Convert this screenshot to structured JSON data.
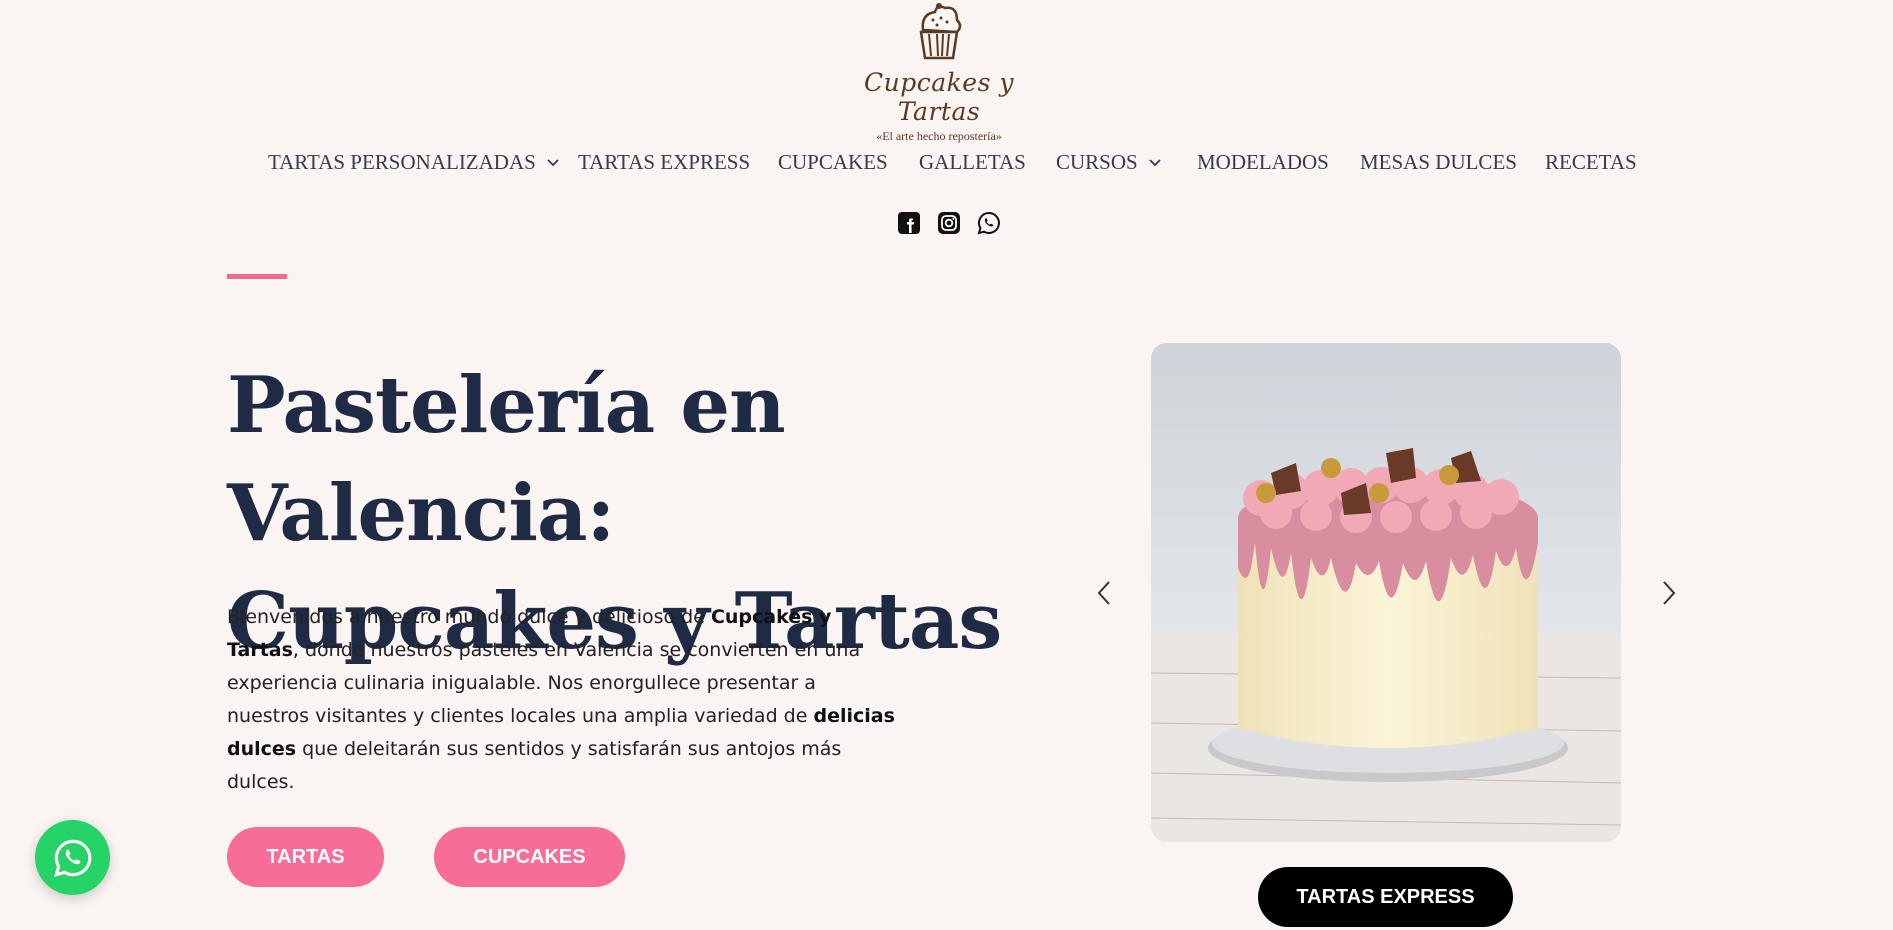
{
  "brand": {
    "name": "Cupcakes y Tartas",
    "tagline": "«El arte hecho repostería»"
  },
  "nav": {
    "items": [
      {
        "label": "TARTAS PERSONALIZADAS",
        "has_dropdown": true
      },
      {
        "label": "TARTAS EXPRESS",
        "has_dropdown": false
      },
      {
        "label": "CUPCAKES",
        "has_dropdown": false
      },
      {
        "label": "GALLETAS",
        "has_dropdown": false
      },
      {
        "label": "CURSOS",
        "has_dropdown": true
      },
      {
        "label": "MODELADOS",
        "has_dropdown": false
      },
      {
        "label": "MESAS DULCES",
        "has_dropdown": false
      },
      {
        "label": "RECETAS",
        "has_dropdown": false
      }
    ]
  },
  "social": [
    "facebook-icon",
    "instagram-icon",
    "whatsapp-icon"
  ],
  "hero": {
    "title_line1": "Pastelería en Valencia:",
    "title_line2": "Cupcakes y Tartas",
    "intro_part1": "Bienvenidos a nuestro mundo dulce y delicioso de ",
    "intro_bold1": "Cupcakes y Tartas",
    "intro_part2": ", donde nuestros pasteles en Valencia se convierten en una experiencia culinaria inigualable. Nos enorgullece presentar a nuestros visitantes y clientes locales una amplia variedad de ",
    "intro_bold2": "delicias dulces",
    "intro_part3": " que deleitarán sus sentidos y satisfarán sus antojos más dulces.",
    "btn_tartas": "TARTAS",
    "btn_cupcakes": "CUPCAKES"
  },
  "slider": {
    "button_label": "TARTAS EXPRESS"
  },
  "colors": {
    "background": "#faf4f2",
    "accent_pink": "#f86d98",
    "heading": "#1f2a44",
    "whatsapp": "#25d366"
  }
}
